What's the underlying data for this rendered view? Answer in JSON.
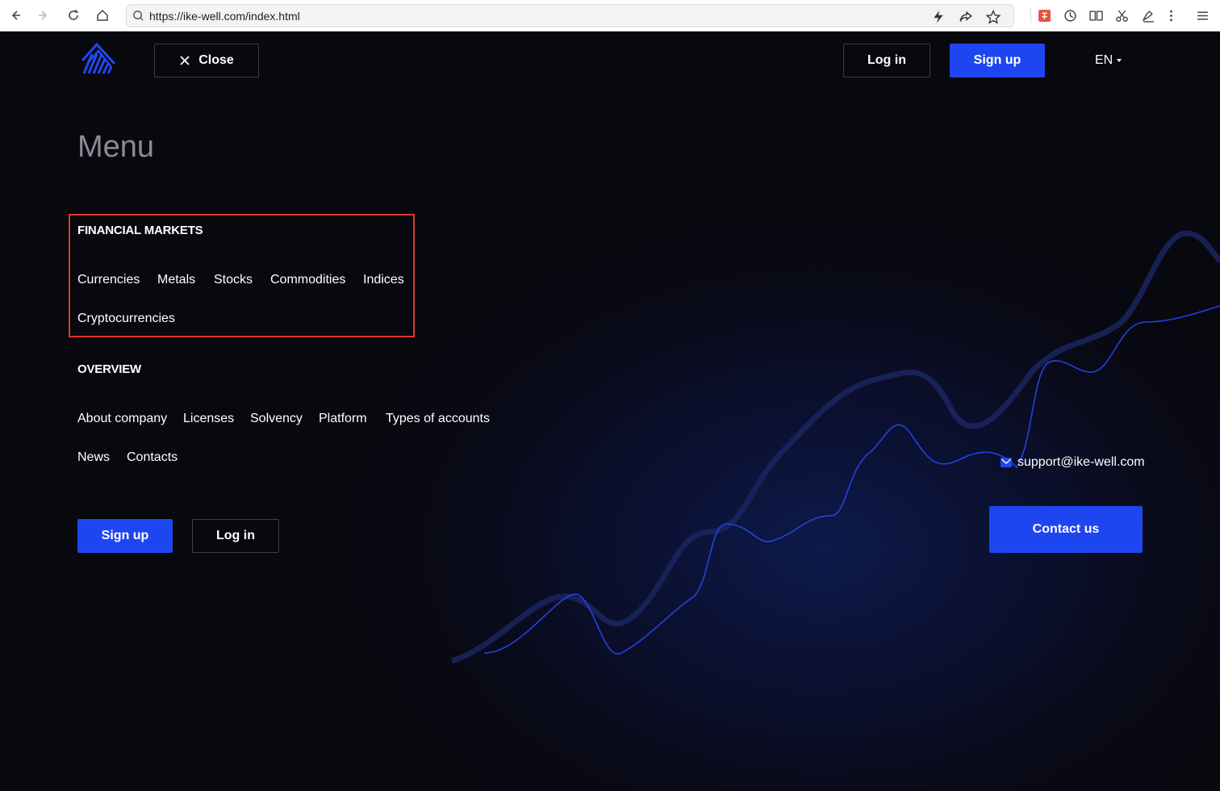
{
  "browser": {
    "url": "https://ike-well.com/index.html"
  },
  "header": {
    "close_label": "Close",
    "login_label": "Log in",
    "signup_label": "Sign up",
    "language": "EN"
  },
  "menu": {
    "title": "Menu",
    "sections": [
      {
        "heading": "FINANCIAL MARKETS",
        "links": [
          "Currencies",
          "Metals",
          "Stocks",
          "Commodities",
          "Indices",
          "Cryptocurrencies"
        ]
      },
      {
        "heading": "OVERVIEW",
        "links": [
          "About company",
          "Licenses",
          "Solvency",
          "Platform",
          "Types of accounts",
          "News",
          "Contacts"
        ]
      }
    ]
  },
  "footer": {
    "signup_label": "Sign up",
    "login_label": "Log in",
    "support_email": "support@ike-well.com",
    "contact_label": "Contact us"
  },
  "colors": {
    "accent": "#1e46f0",
    "highlight_box": "#e0362a",
    "background": "#08080f"
  }
}
